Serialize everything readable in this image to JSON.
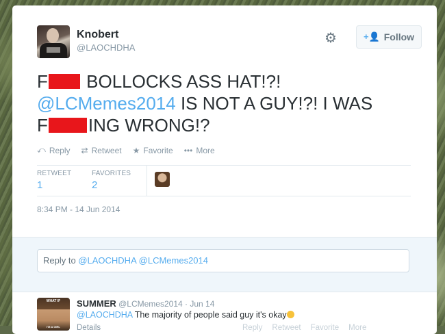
{
  "header": {
    "display_name": "Knobert",
    "username": "@LAOCHDHA",
    "follow_label": "Follow",
    "follow_icon": "+👤",
    "settings_icon": "gear-icon"
  },
  "tweet": {
    "line1_prefix": "F",
    "line1_rest": "BOLLOCKS ASS HAT!?!",
    "line2_mention": "@LCMemes2014",
    "line2_rest": " IS NOT A GUY!?! I WAS",
    "line3_prefix": "F",
    "line3_rest": "ING WRONG!?",
    "redaction_color": "#e8161b"
  },
  "actions": {
    "reply": "Reply",
    "retweet": "Retweet",
    "favorite": "Favorite",
    "more": "More"
  },
  "stats": {
    "retweet_label": "RETWEET",
    "retweet_count": "1",
    "favorites_label": "FAVORITES",
    "favorites_count": "2"
  },
  "timestamp": "8:34 PM - 14 Jun 2014",
  "reply_box": {
    "prefix": "Reply to ",
    "mentions": "@LAOCHDHA @LCMemes2014"
  },
  "reply_tweet": {
    "name": "SUMMER",
    "meta": " @LCMemes2014 · Jun 14",
    "mention": "@LAOCHDHA",
    "text": " The majority of people said guy it's okay",
    "details": "Details",
    "reply": "Reply",
    "retweet": "Retweet",
    "favorite": "Favorite",
    "more": "More",
    "avatar_top_text": "WHAT IF",
    "avatar_bottom_text": "I'M A GIRL"
  },
  "colors": {
    "accent": "#55acee",
    "text": "#292f33",
    "muted": "#8899a6"
  }
}
